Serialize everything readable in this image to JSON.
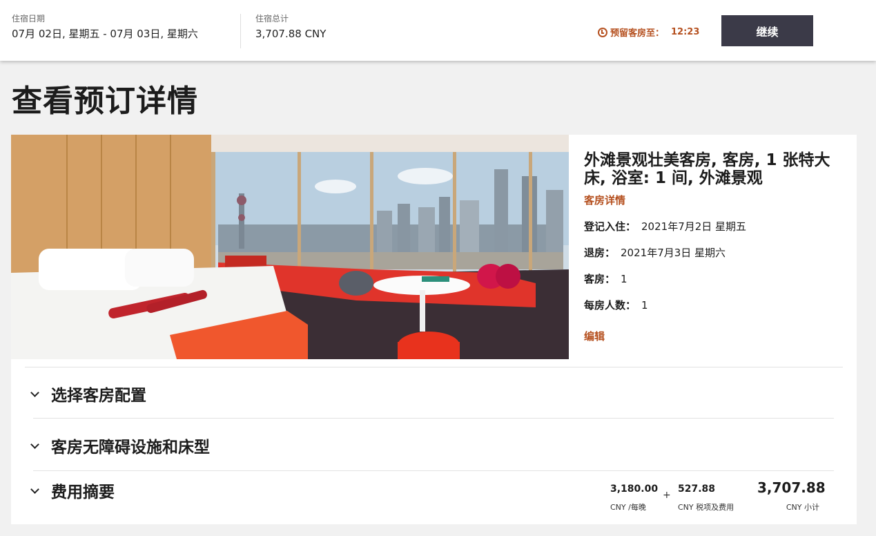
{
  "topbar": {
    "dates_label": "住宿日期",
    "dates_value": "07月 02日, 星期五 - 07月 03日, 星期六",
    "total_label": "住宿总计",
    "total_value": "3,707.88 CNY",
    "hold_label": "预留客房至：",
    "hold_time": "12:23",
    "continue_label": "继续"
  },
  "page_title": "查看预订详情",
  "room": {
    "name": "外滩景观壮美客房, 客房, 1 张特大床, 浴室: 1 间, 外滩景观",
    "details_link": "客房详情",
    "checkin_label": "登记入住：",
    "checkin_value": "2021年7月2日 星期五",
    "checkout_label": "退房：",
    "checkout_value": "2021年7月3日 星期六",
    "rooms_label": "客房：",
    "rooms_value": "1",
    "guests_label": "每房人数：",
    "guests_value": "1",
    "edit_link": "编辑"
  },
  "sections": {
    "room_config": "选择客房配置",
    "accessibility": "客房无障碍设施和床型",
    "fee_summary": "费用摘要"
  },
  "fees": {
    "nightly_value": "3,180.00",
    "nightly_label": "CNY /每晚",
    "plus": "+",
    "taxes_value": "527.88",
    "taxes_label": "CNY 税项及费用",
    "subtotal_value": "3,707.88",
    "subtotal_label": "CNY 小计"
  },
  "colors": {
    "accent": "#b5501f",
    "button": "#3b3a48"
  }
}
